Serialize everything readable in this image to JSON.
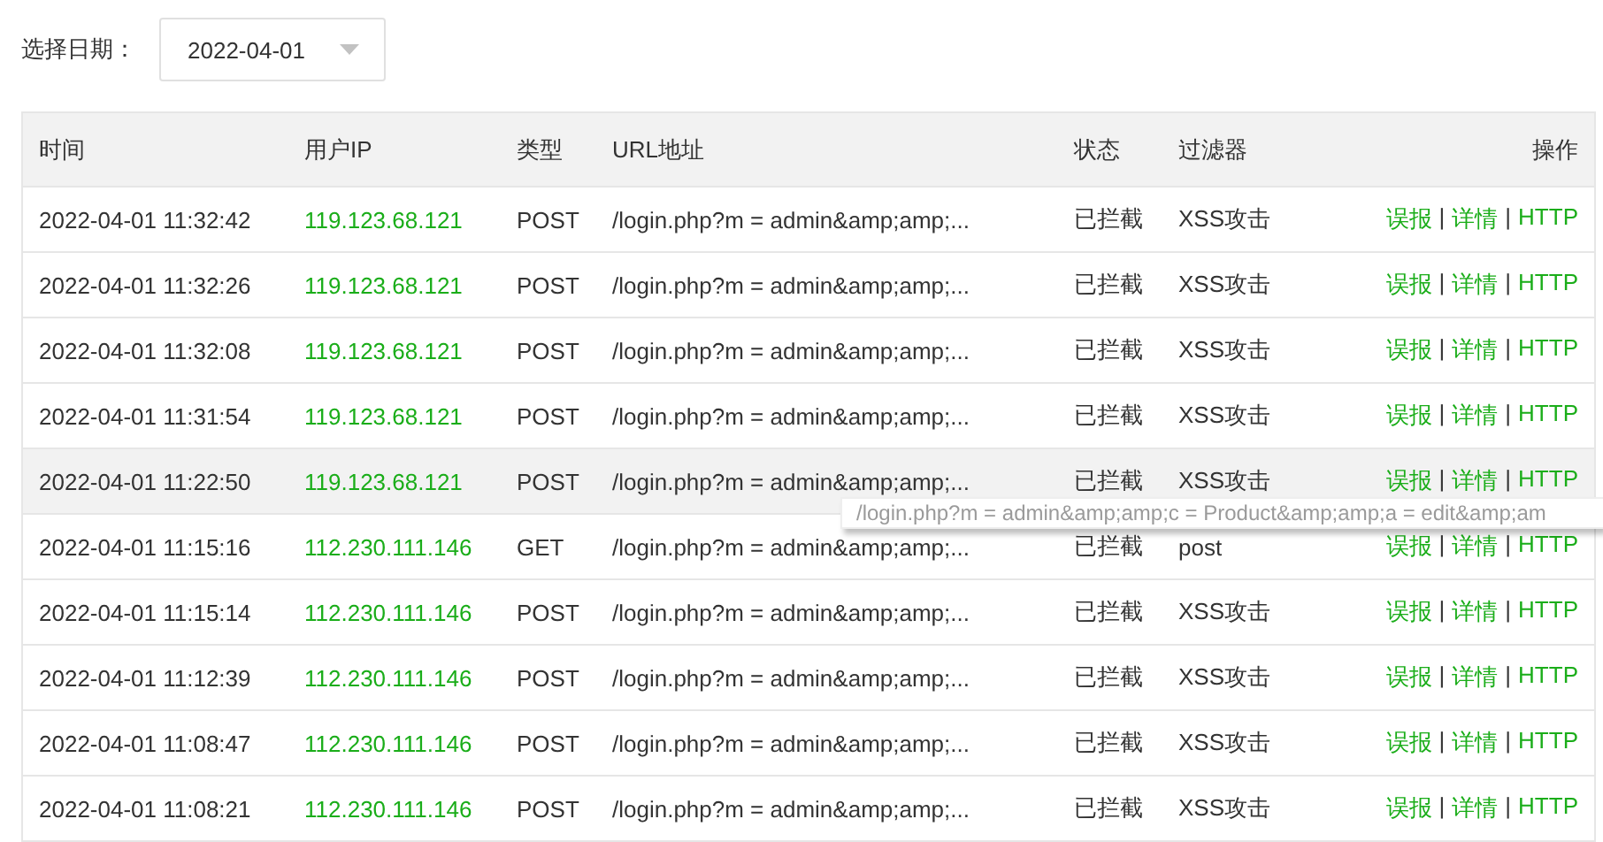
{
  "filter": {
    "label": "选择日期：",
    "date": "2022-04-01"
  },
  "table": {
    "columns": [
      "时间",
      "用户IP",
      "类型",
      "URL地址",
      "状态",
      "过滤器",
      "操作"
    ],
    "rows": [
      {
        "time": "2022-04-01 11:32:42",
        "ip": "119.123.68.121",
        "type": "POST",
        "url": "/login.php?m = admin&amp;amp;...",
        "status": "已拦截",
        "filter": "XSS攻击",
        "hovered": false,
        "actions": [
          {
            "kind": "link",
            "label": "误报"
          },
          {
            "kind": "separator",
            "label": "|"
          },
          {
            "kind": "link",
            "label": "详情"
          },
          {
            "kind": "separator",
            "label": "|"
          },
          {
            "kind": "link",
            "label": "HTTP"
          }
        ]
      },
      {
        "time": "2022-04-01 11:32:26",
        "ip": "119.123.68.121",
        "type": "POST",
        "url": "/login.php?m = admin&amp;amp;...",
        "status": "已拦截",
        "filter": "XSS攻击",
        "hovered": false,
        "actions": [
          {
            "kind": "link",
            "label": "误报"
          },
          {
            "kind": "separator",
            "label": "|"
          },
          {
            "kind": "link",
            "label": "详情"
          },
          {
            "kind": "separator",
            "label": "|"
          },
          {
            "kind": "link",
            "label": "HTTP"
          }
        ]
      },
      {
        "time": "2022-04-01 11:32:08",
        "ip": "119.123.68.121",
        "type": "POST",
        "url": "/login.php?m = admin&amp;amp;...",
        "status": "已拦截",
        "filter": "XSS攻击",
        "hovered": false,
        "actions": [
          {
            "kind": "link",
            "label": "误报"
          },
          {
            "kind": "separator",
            "label": "|"
          },
          {
            "kind": "link",
            "label": "详情"
          },
          {
            "kind": "separator",
            "label": "|"
          },
          {
            "kind": "link",
            "label": "HTTP"
          }
        ]
      },
      {
        "time": "2022-04-01 11:31:54",
        "ip": "119.123.68.121",
        "type": "POST",
        "url": "/login.php?m = admin&amp;amp;...",
        "status": "已拦截",
        "filter": "XSS攻击",
        "hovered": false,
        "actions": [
          {
            "kind": "link",
            "label": "误报"
          },
          {
            "kind": "separator",
            "label": "|"
          },
          {
            "kind": "link",
            "label": "详情"
          },
          {
            "kind": "separator",
            "label": "|"
          },
          {
            "kind": "link",
            "label": "HTTP"
          }
        ]
      },
      {
        "time": "2022-04-01 11:22:50",
        "ip": "119.123.68.121",
        "type": "POST",
        "url": "/login.php?m = admin&amp;amp;...",
        "status": "已拦截",
        "filter": "XSS攻击",
        "hovered": true,
        "actions": [
          {
            "kind": "link",
            "label": "误报"
          },
          {
            "kind": "separator",
            "label": "|"
          },
          {
            "kind": "link",
            "label": "详情"
          },
          {
            "kind": "separator",
            "label": "|"
          },
          {
            "kind": "link",
            "label": "HTTP"
          }
        ]
      },
      {
        "time": "2022-04-01 11:15:16",
        "ip": "112.230.111.146",
        "type": "GET",
        "url": "/login.php?m = admin&amp;amp;...",
        "status": "已拦截",
        "filter": "post",
        "hovered": false,
        "actions": [
          {
            "kind": "link",
            "label": "误报"
          },
          {
            "kind": "separator",
            "label": "|"
          },
          {
            "kind": "link",
            "label": "详情"
          },
          {
            "kind": "separator",
            "label": "|"
          },
          {
            "kind": "link",
            "label": "HTTP"
          }
        ]
      },
      {
        "time": "2022-04-01 11:15:14",
        "ip": "112.230.111.146",
        "type": "POST",
        "url": "/login.php?m = admin&amp;amp;...",
        "status": "已拦截",
        "filter": "XSS攻击",
        "hovered": false,
        "actions": [
          {
            "kind": "link",
            "label": "误报"
          },
          {
            "kind": "separator",
            "label": "|"
          },
          {
            "kind": "link",
            "label": "详情"
          },
          {
            "kind": "separator",
            "label": "|"
          },
          {
            "kind": "link",
            "label": "HTTP"
          }
        ]
      },
      {
        "time": "2022-04-01 11:12:39",
        "ip": "112.230.111.146",
        "type": "POST",
        "url": "/login.php?m = admin&amp;amp;...",
        "status": "已拦截",
        "filter": "XSS攻击",
        "hovered": false,
        "actions": [
          {
            "kind": "link",
            "label": "误报"
          },
          {
            "kind": "separator",
            "label": "|"
          },
          {
            "kind": "link",
            "label": "详情"
          },
          {
            "kind": "separator",
            "label": "|"
          },
          {
            "kind": "link",
            "label": "HTTP"
          }
        ]
      },
      {
        "time": "2022-04-01 11:08:47",
        "ip": "112.230.111.146",
        "type": "POST",
        "url": "/login.php?m = admin&amp;amp;...",
        "status": "已拦截",
        "filter": "XSS攻击",
        "hovered": false,
        "actions": [
          {
            "kind": "link",
            "label": "误报"
          },
          {
            "kind": "separator",
            "label": "|"
          },
          {
            "kind": "link",
            "label": "详情"
          },
          {
            "kind": "separator",
            "label": "|"
          },
          {
            "kind": "link",
            "label": "HTTP"
          }
        ]
      },
      {
        "time": "2022-04-01 11:08:21",
        "ip": "112.230.111.146",
        "type": "POST",
        "url": "/login.php?m = admin&amp;amp;...",
        "status": "已拦截",
        "filter": "XSS攻击",
        "hovered": false,
        "actions": [
          {
            "kind": "link",
            "label": "误报"
          },
          {
            "kind": "separator",
            "label": "|"
          },
          {
            "kind": "link",
            "label": "详情"
          },
          {
            "kind": "separator",
            "label": "|"
          },
          {
            "kind": "link",
            "label": "HTTP"
          }
        ]
      }
    ]
  },
  "tooltip": {
    "text": "/login.php?m = admin&amp;amp;c = Product&amp;amp;a = edit&amp;am"
  }
}
